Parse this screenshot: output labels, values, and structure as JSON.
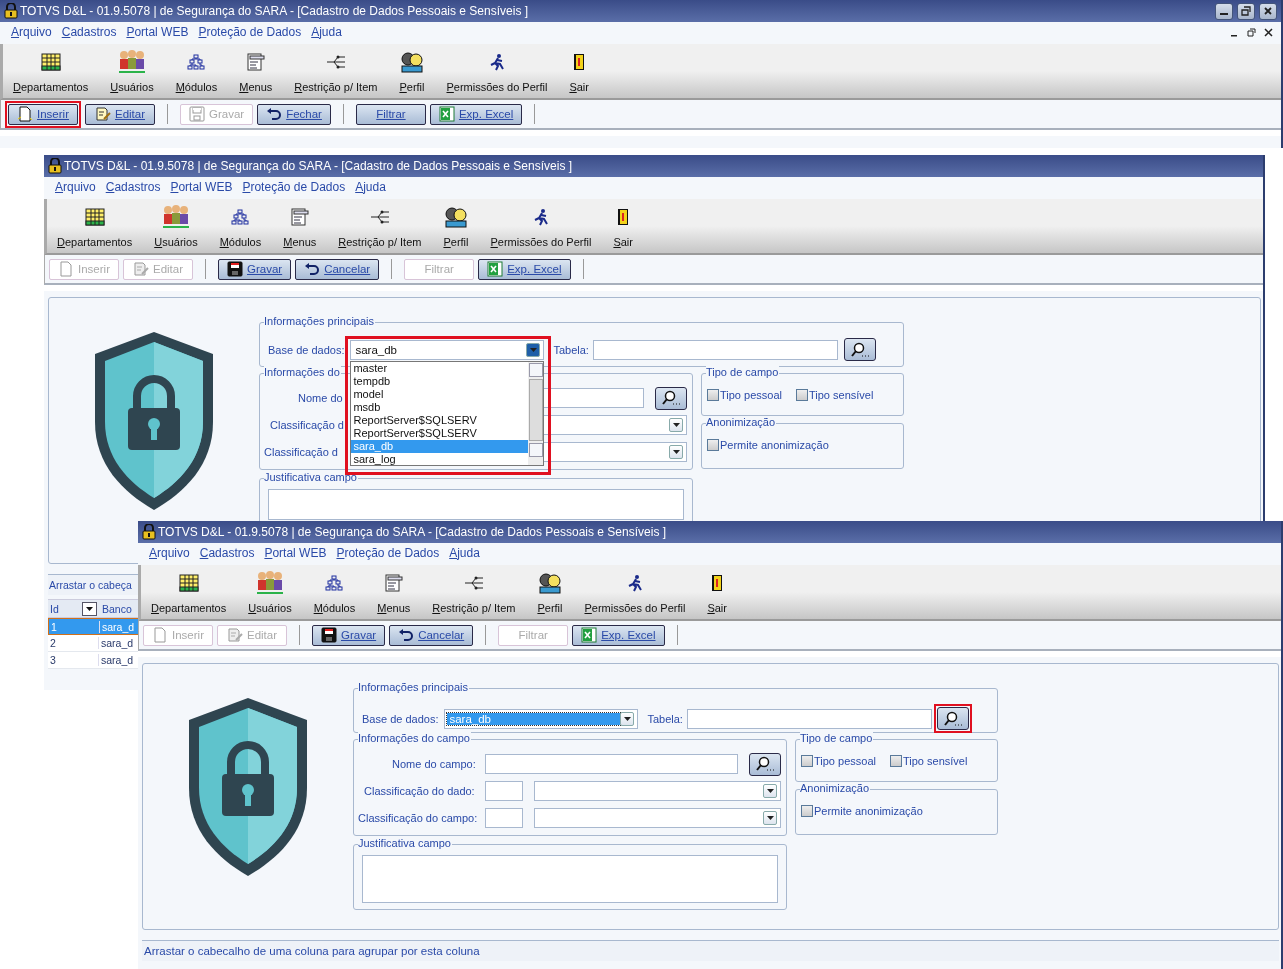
{
  "windows": [
    {
      "title": "TOTVS D&L - 01.9.5078 | de Segurança do SARA - [Cadastro de Dados Pessoais e Sensíveis ]",
      "window_buttons": true,
      "menu": [
        "Arquivo",
        "Cadastros",
        "Portal WEB",
        "Proteção de Dados",
        "Ajuda"
      ],
      "toolbar": [
        {
          "label": "Departamentos",
          "kind": "table"
        },
        {
          "label": "Usuários",
          "kind": "people"
        },
        {
          "label": "Módulos",
          "kind": "hierarchy"
        },
        {
          "label": "Menus",
          "kind": "menu"
        },
        {
          "label": "Restrição p/ Item",
          "kind": "branch"
        },
        {
          "label": "Perfil",
          "kind": "profile"
        },
        {
          "label": "Permissões do Perfil",
          "kind": "runner"
        },
        {
          "label": "Sair",
          "kind": "door"
        }
      ],
      "actions": [
        {
          "label": "Inserir",
          "kind": "new",
          "disabled": false,
          "highlighted": true
        },
        {
          "label": "Editar",
          "kind": "edit",
          "disabled": false,
          "highlighted": false
        },
        {
          "label": "Gravar",
          "kind": "save",
          "disabled": true,
          "highlighted": false
        },
        {
          "label": "Fechar",
          "kind": "undo",
          "disabled": false,
          "highlighted": false
        },
        {
          "label": "Filtrar",
          "kind": "text",
          "disabled": false,
          "highlighted": false
        },
        {
          "label": "Exp. Excel",
          "kind": "excel",
          "disabled": false,
          "highlighted": false
        }
      ]
    },
    {
      "title": "TOTVS D&L - 01.9.5078 | de Segurança do SARA - [Cadastro de Dados Pessoais e Sensíveis ]",
      "menu": [
        "Arquivo",
        "Cadastros",
        "Portal WEB",
        "Proteção de Dados",
        "Ajuda"
      ],
      "toolbar": [
        {
          "label": "Departamentos",
          "kind": "table"
        },
        {
          "label": "Usuários",
          "kind": "people"
        },
        {
          "label": "Módulos",
          "kind": "hierarchy"
        },
        {
          "label": "Menus",
          "kind": "menu"
        },
        {
          "label": "Restrição p/ Item",
          "kind": "branch"
        },
        {
          "label": "Perfil",
          "kind": "profile"
        },
        {
          "label": "Permissões do Perfil",
          "kind": "runner"
        },
        {
          "label": "Sair",
          "kind": "door"
        }
      ],
      "actions": [
        {
          "label": "Inserir",
          "kind": "new",
          "disabled": true,
          "highlighted": false
        },
        {
          "label": "Editar",
          "kind": "edit",
          "disabled": true,
          "highlighted": false
        },
        {
          "label": "Gravar",
          "kind": "save",
          "disabled": false,
          "highlighted": false
        },
        {
          "label": "Cancelar",
          "kind": "undo",
          "disabled": false,
          "highlighted": false
        },
        {
          "label": "Filtrar",
          "kind": "text",
          "disabled": true,
          "highlighted": false
        },
        {
          "label": "Exp. Excel",
          "kind": "excel",
          "disabled": false,
          "highlighted": false
        }
      ],
      "form": {
        "main": {
          "title": "Informações principais",
          "base_label": "Base de dados:",
          "base_value": "sara_db",
          "value_selected": false,
          "open": true,
          "highlighted": true,
          "options": [
            {
              "label": "master",
              "selected": false
            },
            {
              "label": "tempdb",
              "selected": false
            },
            {
              "label": "model",
              "selected": false
            },
            {
              "label": "msdb",
              "selected": false
            },
            {
              "label": "ReportServer$SQLSERV",
              "selected": false
            },
            {
              "label": "ReportServer$SQLSERV",
              "selected": false
            },
            {
              "label": "sara_db",
              "selected": true
            },
            {
              "label": "sara_log",
              "selected": false
            }
          ],
          "table_label": "Tabela:",
          "search_highlighted": false
        },
        "field": {
          "title": "Informações do",
          "name_label": "Nome do",
          "data_label": "Classificação d",
          "field_label": "Classificação d"
        },
        "type": {
          "title": "Tipo de campo",
          "checks": [
            {
              "label": "Tipo pessoal",
              "checked": false
            },
            {
              "label": "Tipo sensível",
              "checked": false
            }
          ]
        },
        "anon": {
          "title": "Anonimização",
          "checks": [
            {
              "label": "Permite anonimização",
              "checked": false
            }
          ]
        },
        "justification": {
          "title": "Justificativa campo"
        }
      },
      "grid": {
        "group_hint": "Arrastar o cabeça",
        "columns": [
          "Id",
          "Banco"
        ],
        "rows": [
          {
            "cells": [
              "1",
              "sara_d"
            ],
            "selected": true
          },
          {
            "cells": [
              "2",
              "sara_d"
            ],
            "selected": false
          },
          {
            "cells": [
              "3",
              "sara_d"
            ],
            "selected": false
          }
        ]
      }
    },
    {
      "title": "TOTVS D&L - 01.9.5078 | de Segurança do SARA - [Cadastro de Dados Pessoais e Sensíveis ]",
      "menu": [
        "Arquivo",
        "Cadastros",
        "Portal WEB",
        "Proteção de Dados",
        "Ajuda"
      ],
      "toolbar": [
        {
          "label": "Departamentos",
          "kind": "table"
        },
        {
          "label": "Usuários",
          "kind": "people"
        },
        {
          "label": "Módulos",
          "kind": "hierarchy"
        },
        {
          "label": "Menus",
          "kind": "menu"
        },
        {
          "label": "Restrição p/ Item",
          "kind": "branch"
        },
        {
          "label": "Perfil",
          "kind": "profile"
        },
        {
          "label": "Permissões do Perfil",
          "kind": "runner"
        },
        {
          "label": "Sair",
          "kind": "door"
        }
      ],
      "actions": [
        {
          "label": "Inserir",
          "kind": "new",
          "disabled": true,
          "highlighted": false
        },
        {
          "label": "Editar",
          "kind": "edit",
          "disabled": true,
          "highlighted": false
        },
        {
          "label": "Gravar",
          "kind": "save",
          "disabled": false,
          "highlighted": false
        },
        {
          "label": "Cancelar",
          "kind": "undo",
          "disabled": false,
          "highlighted": false
        },
        {
          "label": "Filtrar",
          "kind": "text",
          "disabled": true,
          "highlighted": false
        },
        {
          "label": "Exp. Excel",
          "kind": "excel",
          "disabled": false,
          "highlighted": false
        }
      ],
      "form": {
        "main": {
          "title": "Informações principais",
          "base_label": "Base de dados:",
          "base_value": "sara_db",
          "value_selected": true,
          "open": false,
          "highlighted": false,
          "table_label": "Tabela:",
          "search_highlighted": true
        },
        "field": {
          "title": "Informações do campo",
          "name_label": "Nome do campo:",
          "data_label": "Classificação do dado:",
          "field_label": "Classificação do campo:"
        },
        "type": {
          "title": "Tipo de campo",
          "checks": [
            {
              "label": "Tipo pessoal",
              "checked": false
            },
            {
              "label": "Tipo sensível",
              "checked": false
            }
          ]
        },
        "anon": {
          "title": "Anonimização",
          "checks": [
            {
              "label": "Permite anonimização",
              "checked": false
            }
          ]
        },
        "justification": {
          "title": "Justificativa campo"
        }
      },
      "grid": {
        "group_hint": "Arrastar o cabecalho de uma coluna para agrupar por esta coluna"
      }
    }
  ]
}
